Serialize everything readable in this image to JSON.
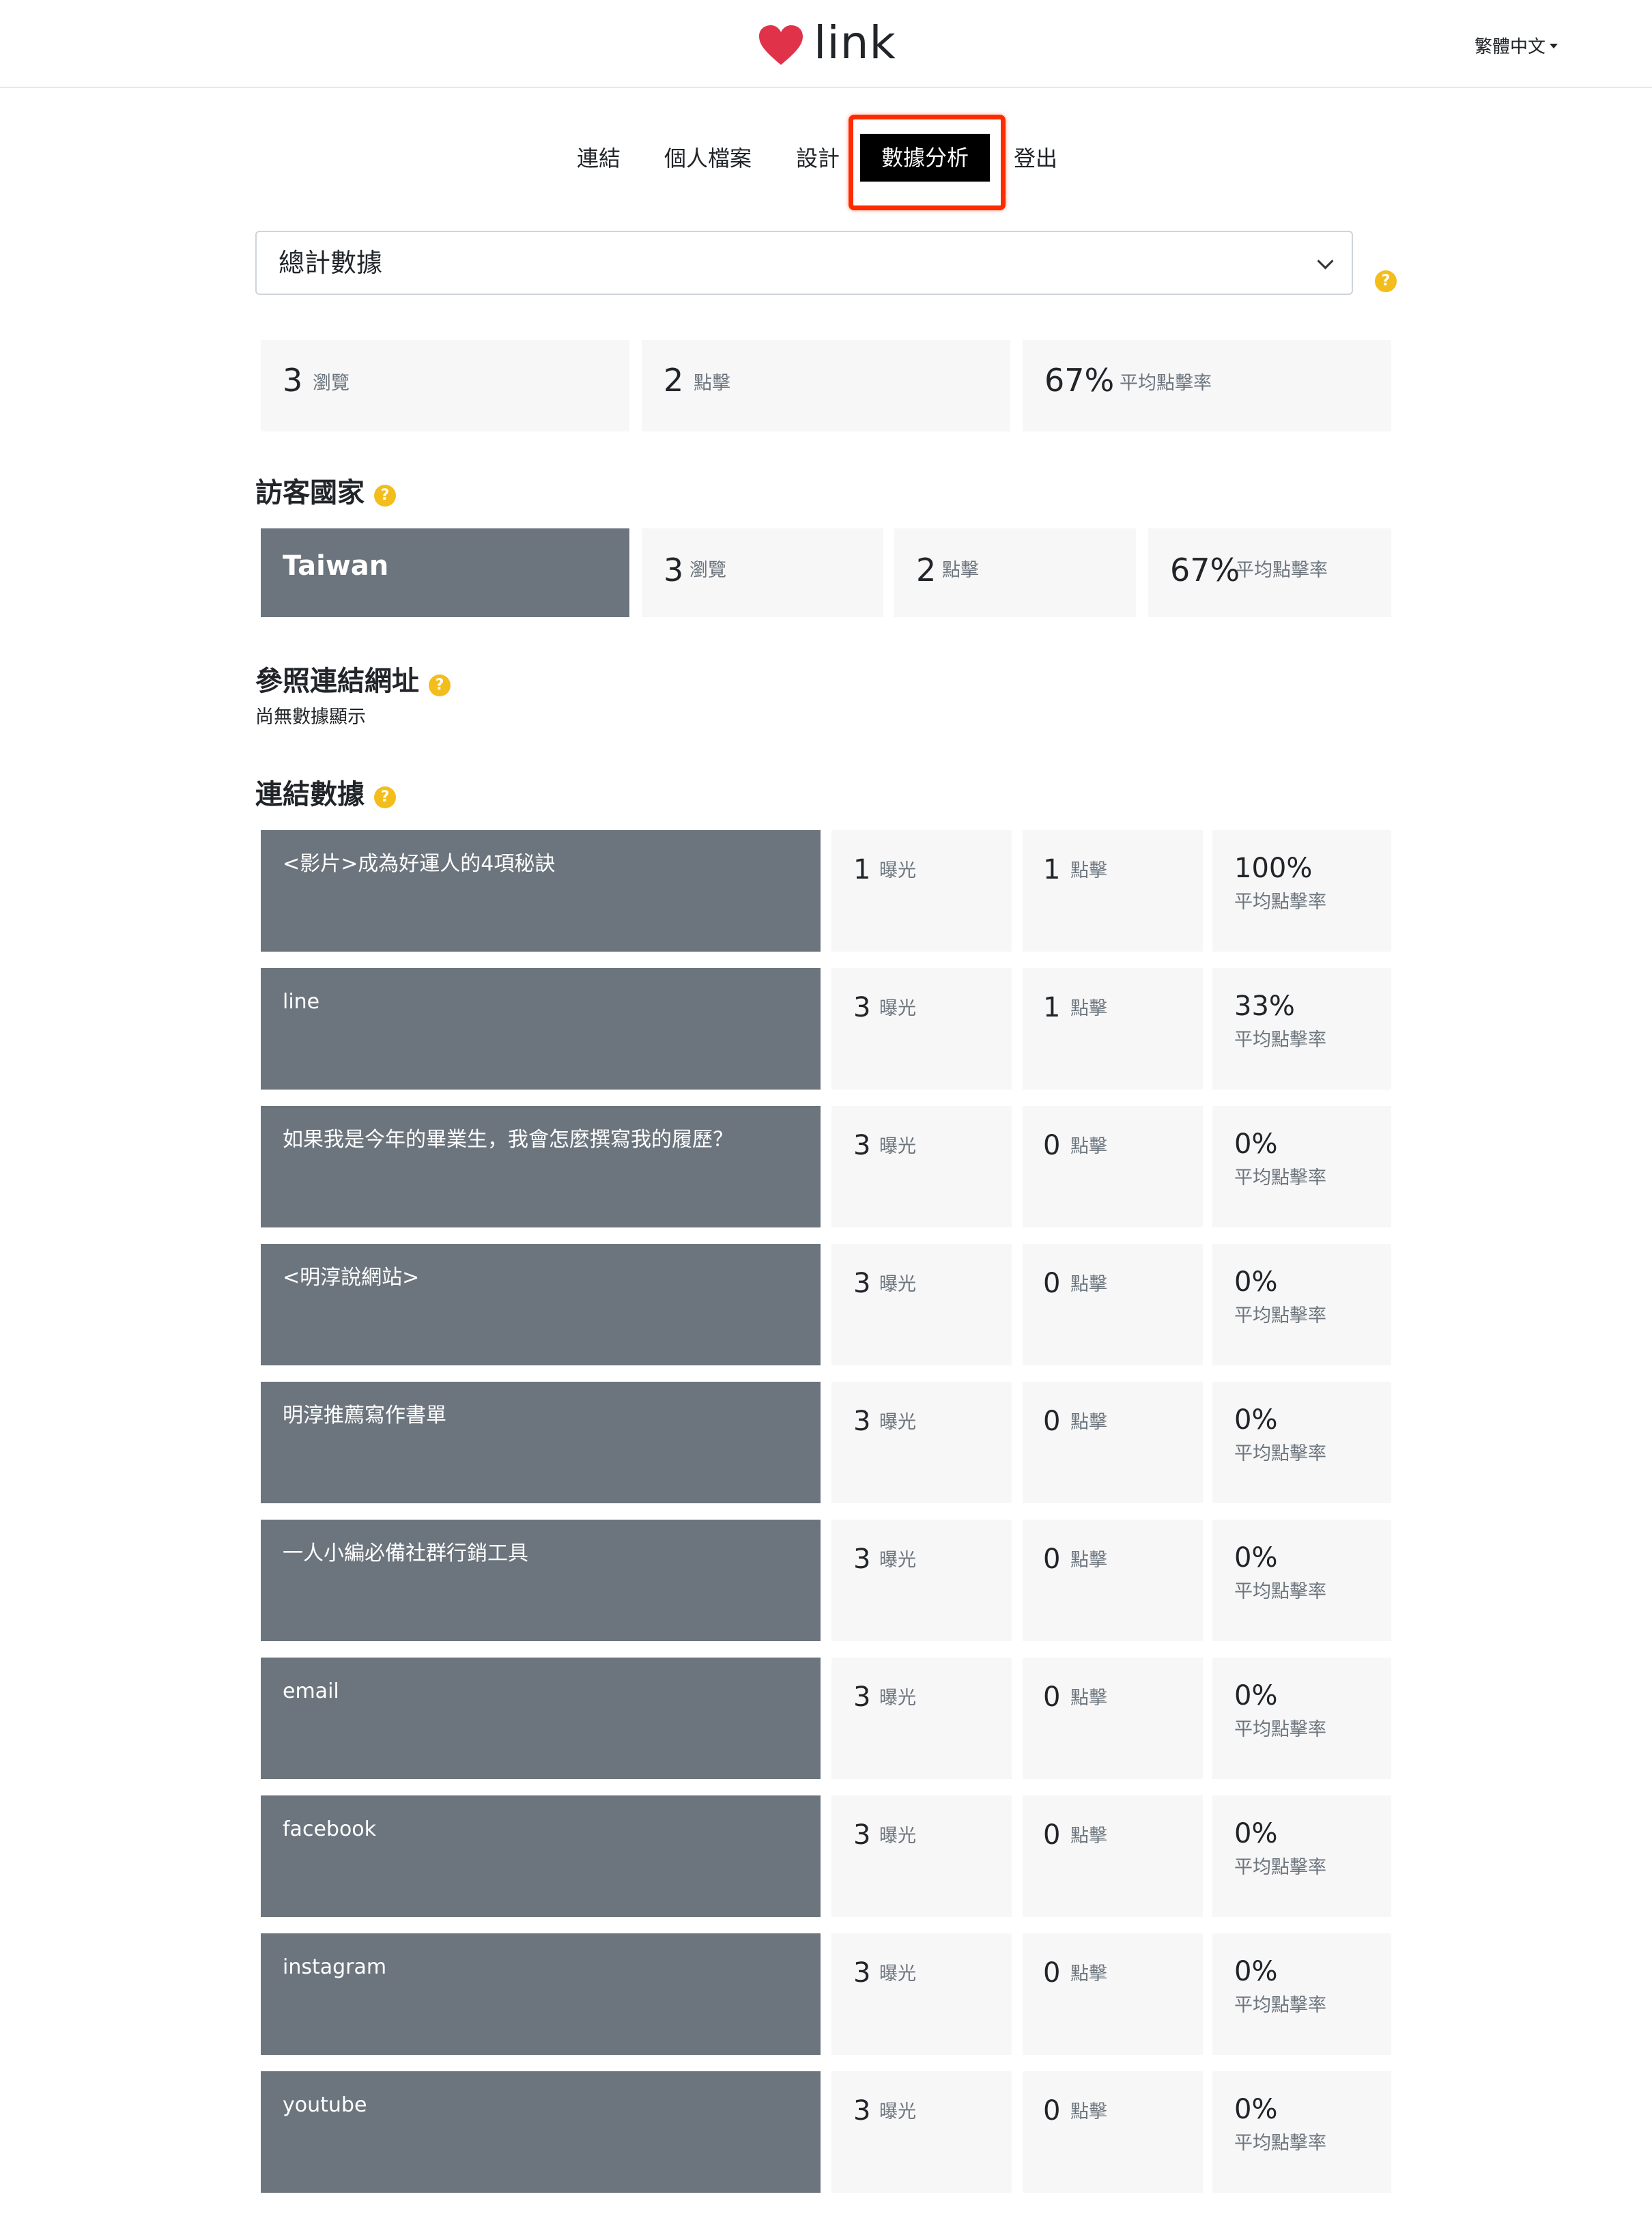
{
  "header": {
    "logo_text": "link",
    "language": "繁體中文"
  },
  "nav": {
    "items": [
      "連結",
      "個人檔案",
      "設計",
      "數據分析",
      "登出"
    ],
    "active": "數據分析"
  },
  "filter": {
    "selected": "總計數據"
  },
  "summary": {
    "views": "3",
    "views_label": "瀏覽",
    "clicks": "2",
    "clicks_label": "點擊",
    "ctr": "67%",
    "ctr_label": "平均點擊率"
  },
  "countries": {
    "title": "訪客國家",
    "rows": [
      {
        "name": "Taiwan",
        "views": "3",
        "views_label": "瀏覽",
        "clicks": "2",
        "clicks_label": "點擊",
        "ctr": "67%",
        "ctr_label": "平均點擊率"
      }
    ]
  },
  "referrers": {
    "title": "參照連結網址",
    "empty": "尚無數據顯示"
  },
  "links": {
    "title": "連結數據",
    "impressions_label": "曝光",
    "clicks_label": "點擊",
    "ctr_label": "平均點擊率",
    "rows": [
      {
        "title": "<影片>成為好運人的4項秘訣",
        "impressions": "1",
        "clicks": "1",
        "ctr": "100%"
      },
      {
        "title": "line",
        "impressions": "3",
        "clicks": "1",
        "ctr": "33%"
      },
      {
        "title": "如果我是今年的畢業生，我會怎麼撰寫我的履歷？",
        "impressions": "3",
        "clicks": "0",
        "ctr": "0%"
      },
      {
        "title": "<明淳說網站>",
        "impressions": "3",
        "clicks": "0",
        "ctr": "0%"
      },
      {
        "title": "明淳推薦寫作書單",
        "impressions": "3",
        "clicks": "0",
        "ctr": "0%"
      },
      {
        "title": "一人小編必備社群行銷工具",
        "impressions": "3",
        "clicks": "0",
        "ctr": "0%"
      },
      {
        "title": "email",
        "impressions": "3",
        "clicks": "0",
        "ctr": "0%"
      },
      {
        "title": "facebook",
        "impressions": "3",
        "clicks": "0",
        "ctr": "0%"
      },
      {
        "title": "instagram",
        "impressions": "3",
        "clicks": "0",
        "ctr": "0%"
      },
      {
        "title": "youtube",
        "impressions": "3",
        "clicks": "0",
        "ctr": "0%"
      }
    ]
  },
  "help_glyph": "?",
  "colors": {
    "accent_heart": "#e0334a",
    "highlight": "#ff2a00",
    "dark_card": "#6c757d",
    "help": "#f3bd1c"
  }
}
